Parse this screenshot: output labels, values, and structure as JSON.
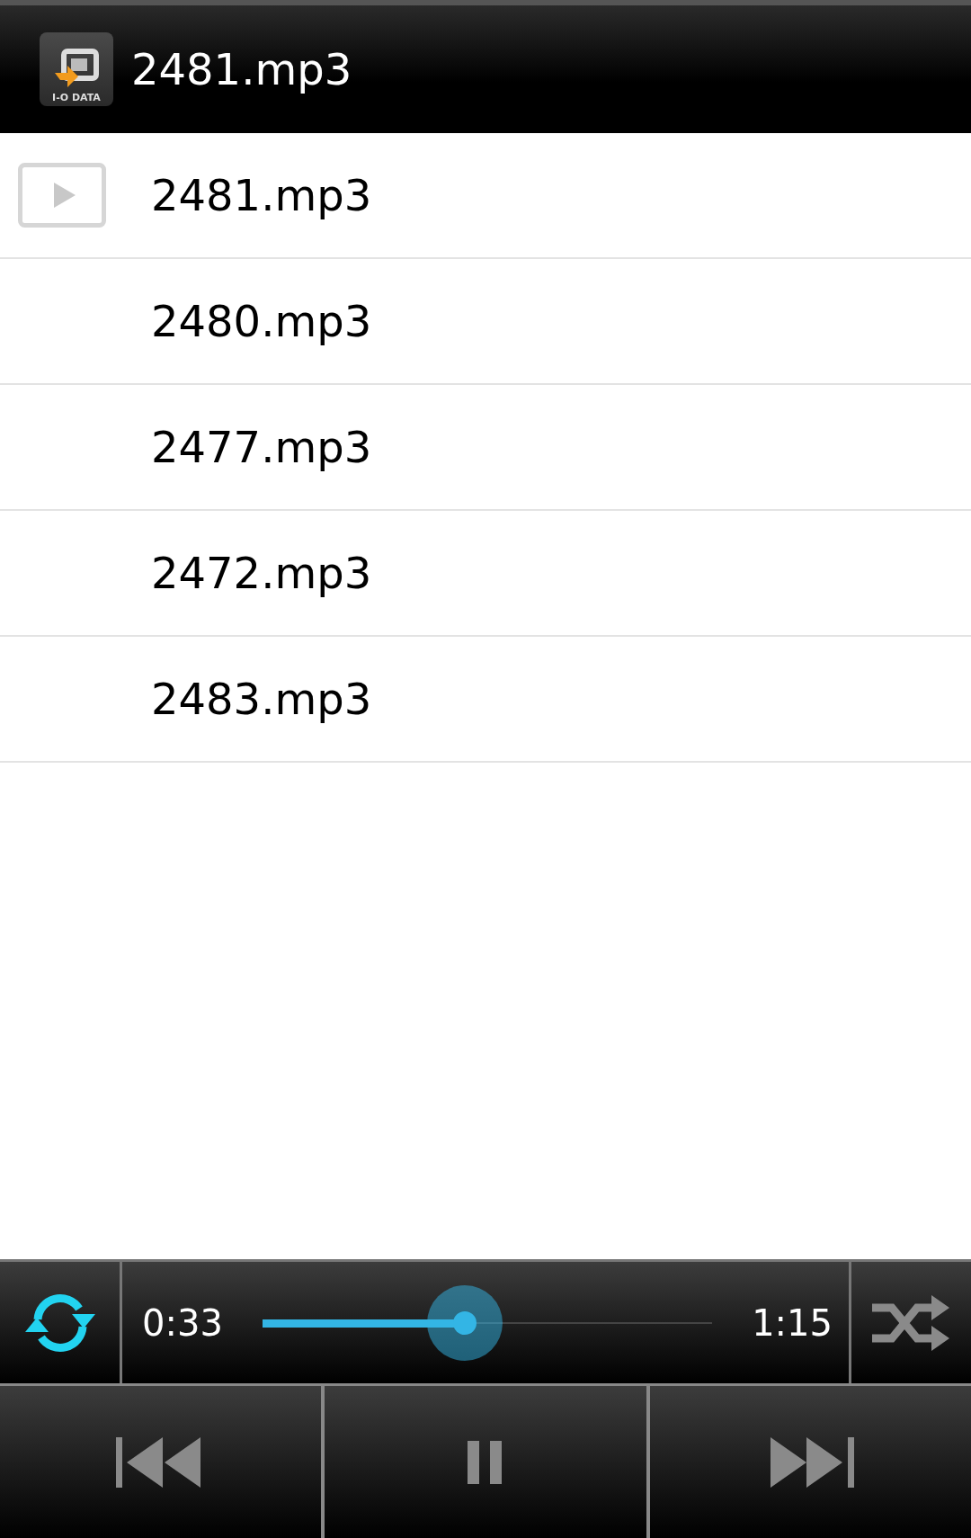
{
  "header": {
    "logo_text": "I-O DATA",
    "title": "2481.mp3"
  },
  "tracks": [
    {
      "name": "2481.mp3",
      "playing": true
    },
    {
      "name": "2480.mp3",
      "playing": false
    },
    {
      "name": "2477.mp3",
      "playing": false
    },
    {
      "name": "2472.mp3",
      "playing": false
    },
    {
      "name": "2483.mp3",
      "playing": false
    }
  ],
  "player": {
    "repeat": true,
    "shuffle": false,
    "elapsed": "0:33",
    "duration": "1:15",
    "level": 0.45,
    "paused": false
  }
}
